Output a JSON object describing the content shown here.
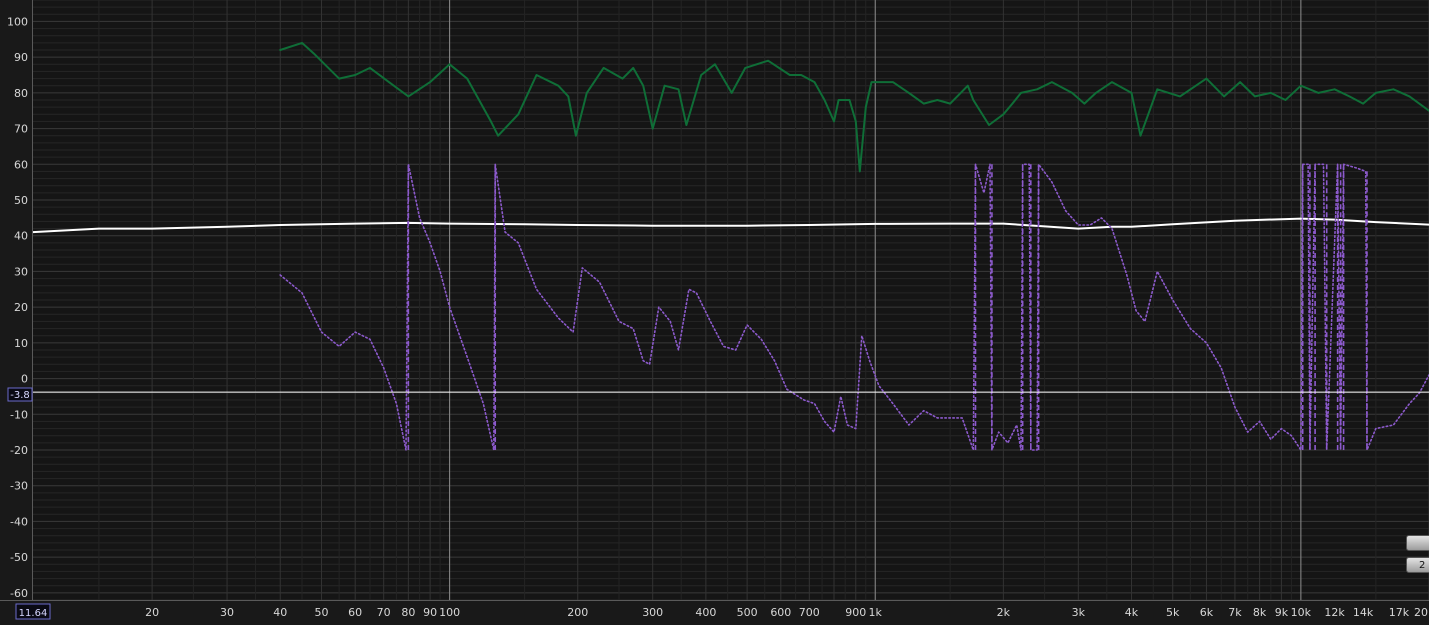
{
  "chart_data": {
    "type": "line",
    "x_scale": "log",
    "xlim": [
      10.5,
      20000
    ],
    "ylim": [
      -62,
      106
    ],
    "y_ticks": [
      100,
      90,
      80,
      70,
      60,
      50,
      40,
      30,
      20,
      10,
      0,
      -10,
      -20,
      -30,
      -40,
      -50,
      -60
    ],
    "x_ticks": [
      {
        "v": 20,
        "label": "20"
      },
      {
        "v": 30,
        "label": "30"
      },
      {
        "v": 40,
        "label": "40"
      },
      {
        "v": 50,
        "label": "50"
      },
      {
        "v": 60,
        "label": "60"
      },
      {
        "v": 70,
        "label": "70"
      },
      {
        "v": 80,
        "label": "80"
      },
      {
        "v": 90,
        "label": "90"
      },
      {
        "v": 100,
        "label": "100"
      },
      {
        "v": 200,
        "label": "200"
      },
      {
        "v": 300,
        "label": "300"
      },
      {
        "v": 400,
        "label": "400"
      },
      {
        "v": 500,
        "label": "500"
      },
      {
        "v": 600,
        "label": "600"
      },
      {
        "v": 700,
        "label": "700"
      },
      {
        "v": 900,
        "label": "900"
      },
      {
        "v": 1000,
        "label": "1k"
      },
      {
        "v": 2000,
        "label": "2k"
      },
      {
        "v": 3000,
        "label": "3k"
      },
      {
        "v": 4000,
        "label": "4k"
      },
      {
        "v": 5000,
        "label": "5k"
      },
      {
        "v": 6000,
        "label": "6k"
      },
      {
        "v": 7000,
        "label": "7k"
      },
      {
        "v": 8000,
        "label": "8k"
      },
      {
        "v": 9000,
        "label": "9k"
      },
      {
        "v": 10000,
        "label": "10k"
      },
      {
        "v": 12000,
        "label": "12k"
      },
      {
        "v": 14000,
        "label": "14k"
      },
      {
        "v": 17000,
        "label": "17k"
      },
      {
        "v": 20000,
        "label": "20"
      }
    ],
    "grid": true,
    "cursor": {
      "x_readout": "11.64",
      "y_value": -3.8,
      "y_readout": "-3.8"
    },
    "series": [
      {
        "color": "#0f6e37",
        "style": "solid",
        "points": [
          [
            40,
            92
          ],
          [
            45,
            94
          ],
          [
            48,
            91
          ],
          [
            55,
            84
          ],
          [
            60,
            85
          ],
          [
            65,
            87
          ],
          [
            72,
            83
          ],
          [
            80,
            79
          ],
          [
            90,
            83
          ],
          [
            100,
            88
          ],
          [
            110,
            84
          ],
          [
            125,
            72
          ],
          [
            130,
            68
          ],
          [
            145,
            74
          ],
          [
            160,
            85
          ],
          [
            180,
            82
          ],
          [
            190,
            79
          ],
          [
            198,
            68
          ],
          [
            210,
            80
          ],
          [
            230,
            87
          ],
          [
            255,
            84
          ],
          [
            270,
            87
          ],
          [
            285,
            82
          ],
          [
            300,
            70
          ],
          [
            320,
            82
          ],
          [
            345,
            81
          ],
          [
            360,
            71
          ],
          [
            390,
            85
          ],
          [
            420,
            88
          ],
          [
            460,
            80
          ],
          [
            495,
            87
          ],
          [
            560,
            89
          ],
          [
            630,
            85
          ],
          [
            670,
            85
          ],
          [
            720,
            83
          ],
          [
            760,
            78
          ],
          [
            800,
            72
          ],
          [
            820,
            78
          ],
          [
            870,
            78
          ],
          [
            900,
            72
          ],
          [
            920,
            58
          ],
          [
            950,
            76
          ],
          [
            980,
            83
          ],
          [
            1020,
            83
          ],
          [
            1100,
            83
          ],
          [
            1200,
            80
          ],
          [
            1300,
            77
          ],
          [
            1400,
            78
          ],
          [
            1500,
            77
          ],
          [
            1650,
            82
          ],
          [
            1700,
            78
          ],
          [
            1850,
            71
          ],
          [
            2000,
            74
          ],
          [
            2100,
            77
          ],
          [
            2200,
            80
          ],
          [
            2400,
            81
          ],
          [
            2600,
            83
          ],
          [
            2900,
            80
          ],
          [
            3100,
            77
          ],
          [
            3300,
            80
          ],
          [
            3600,
            83
          ],
          [
            4000,
            80
          ],
          [
            4200,
            68
          ],
          [
            4600,
            81
          ],
          [
            5200,
            79
          ],
          [
            6000,
            84
          ],
          [
            6600,
            79
          ],
          [
            7200,
            83
          ],
          [
            7800,
            79
          ],
          [
            8500,
            80
          ],
          [
            9200,
            78
          ],
          [
            10000,
            82
          ],
          [
            11000,
            80
          ],
          [
            12000,
            81
          ],
          [
            13000,
            79
          ],
          [
            14000,
            77
          ],
          [
            15000,
            80
          ],
          [
            16500,
            81
          ],
          [
            18000,
            79
          ],
          [
            20000,
            75
          ]
        ]
      },
      {
        "color": "#ffffff",
        "style": "solid",
        "points": [
          [
            10.5,
            41
          ],
          [
            15,
            42
          ],
          [
            20,
            42
          ],
          [
            30,
            42.5
          ],
          [
            40,
            43
          ],
          [
            60,
            43.4
          ],
          [
            80,
            43.6
          ],
          [
            100,
            43.4
          ],
          [
            150,
            43.2
          ],
          [
            200,
            43
          ],
          [
            300,
            42.8
          ],
          [
            500,
            42.8
          ],
          [
            700,
            43
          ],
          [
            1000,
            43.3
          ],
          [
            1500,
            43.4
          ],
          [
            2000,
            43.4
          ],
          [
            2500,
            42.6
          ],
          [
            3000,
            42
          ],
          [
            3600,
            42.5
          ],
          [
            4000,
            42.5
          ],
          [
            5000,
            43.2
          ],
          [
            7000,
            44.2
          ],
          [
            10000,
            44.8
          ],
          [
            12000,
            44.5
          ],
          [
            15000,
            43.8
          ],
          [
            20000,
            43.1
          ]
        ]
      },
      {
        "color": "#8c5acc",
        "style": "dotted",
        "points": [
          [
            40,
            29
          ],
          [
            45,
            24
          ],
          [
            50,
            13
          ],
          [
            55,
            9
          ],
          [
            60,
            13
          ],
          [
            65,
            11
          ],
          [
            70,
            3
          ],
          [
            75,
            -7
          ],
          [
            79,
            -20
          ],
          [
            80,
            60
          ],
          [
            85,
            45
          ],
          [
            90,
            38
          ],
          [
            95,
            30
          ],
          [
            100,
            20
          ],
          [
            110,
            6
          ],
          [
            120,
            -7
          ],
          [
            127,
            -20
          ],
          [
            128,
            60
          ],
          [
            135,
            41
          ],
          [
            145,
            38
          ],
          [
            160,
            25
          ],
          [
            180,
            17
          ],
          [
            195,
            13
          ],
          [
            205,
            31
          ],
          [
            225,
            27
          ],
          [
            250,
            16
          ],
          [
            270,
            14
          ],
          [
            285,
            5
          ],
          [
            295,
            4
          ],
          [
            310,
            20
          ],
          [
            330,
            16
          ],
          [
            345,
            8
          ],
          [
            365,
            25
          ],
          [
            380,
            24
          ],
          [
            410,
            16
          ],
          [
            440,
            9
          ],
          [
            470,
            8
          ],
          [
            500,
            15
          ],
          [
            540,
            11
          ],
          [
            580,
            5
          ],
          [
            620,
            -3
          ],
          [
            680,
            -6
          ],
          [
            720,
            -7
          ],
          [
            760,
            -12
          ],
          [
            800,
            -15
          ],
          [
            830,
            -5
          ],
          [
            860,
            -13
          ],
          [
            900,
            -14
          ],
          [
            930,
            12
          ],
          [
            970,
            5
          ],
          [
            1020,
            -2
          ],
          [
            1100,
            -7
          ],
          [
            1200,
            -13
          ],
          [
            1300,
            -9
          ],
          [
            1400,
            -11
          ],
          [
            1500,
            -11
          ],
          [
            1600,
            -11
          ],
          [
            1700,
            -20
          ],
          [
            1720,
            60
          ],
          [
            1800,
            52
          ],
          [
            1860,
            60
          ],
          [
            1880,
            -20
          ],
          [
            1950,
            -15
          ],
          [
            2050,
            -18
          ],
          [
            2150,
            -13
          ],
          [
            2200,
            -20
          ],
          [
            2220,
            60
          ],
          [
            2300,
            60
          ],
          [
            2320,
            -20
          ],
          [
            2400,
            -20
          ],
          [
            2420,
            60
          ],
          [
            2600,
            55
          ],
          [
            2800,
            47
          ],
          [
            3000,
            43
          ],
          [
            3200,
            43
          ],
          [
            3400,
            45
          ],
          [
            3600,
            42
          ],
          [
            3900,
            29
          ],
          [
            4100,
            19
          ],
          [
            4300,
            16
          ],
          [
            4600,
            30
          ],
          [
            5000,
            22
          ],
          [
            5500,
            14
          ],
          [
            6000,
            10
          ],
          [
            6500,
            3
          ],
          [
            7000,
            -8
          ],
          [
            7500,
            -15
          ],
          [
            8000,
            -12
          ],
          [
            8500,
            -17
          ],
          [
            9000,
            -14
          ],
          [
            9500,
            -16
          ],
          [
            10000,
            -20
          ],
          [
            10100,
            60
          ],
          [
            10400,
            60
          ],
          [
            10500,
            -20
          ],
          [
            10800,
            60
          ],
          [
            11300,
            60
          ],
          [
            11500,
            -20
          ],
          [
            12200,
            60
          ],
          [
            12400,
            -20
          ],
          [
            12600,
            60
          ],
          [
            13500,
            59
          ],
          [
            14200,
            58
          ],
          [
            14300,
            -20
          ],
          [
            15000,
            -14
          ],
          [
            16500,
            -13
          ],
          [
            18000,
            -7
          ],
          [
            19000,
            -4
          ],
          [
            20000,
            1
          ]
        ]
      }
    ],
    "side_buttons": [
      "",
      "2"
    ]
  }
}
